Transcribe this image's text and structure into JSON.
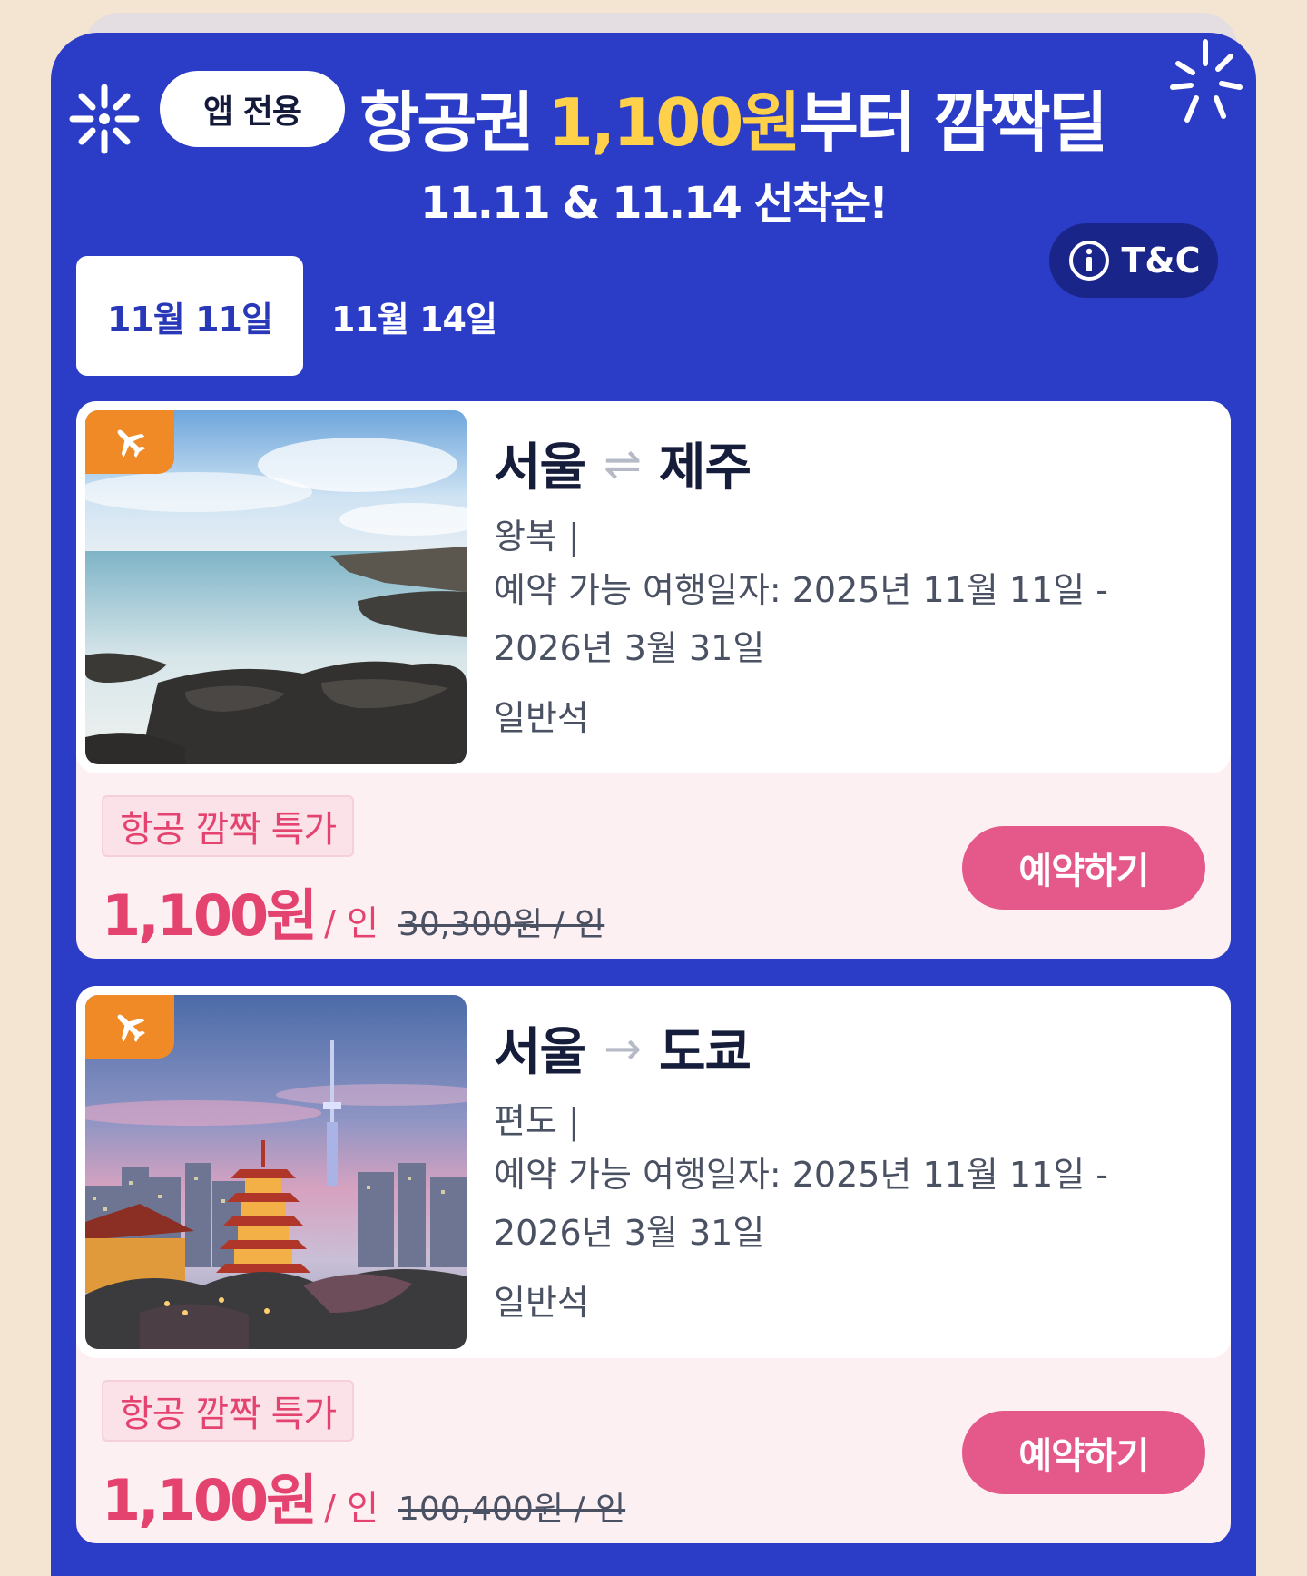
{
  "header": {
    "badge_label": "앱 전용",
    "headline_prefix": "항공권",
    "headline_price": "1,100원",
    "headline_suffix": "부터 깜짝딜",
    "subline": "11.11 & 11.14 선착순!",
    "tc_label": "T&C"
  },
  "tabs": [
    {
      "label": "11월 11일",
      "active": true
    },
    {
      "label": "11월 14일",
      "active": false
    }
  ],
  "deals": [
    {
      "origin": "서울",
      "route_arrow": "⇌",
      "destination": "제주",
      "trip_type": "왕복 |",
      "dates_line1": "예약 가능 여행일자:  2025년 11월 11일  -",
      "dates_line2": "2026년 3월 31일",
      "seat_class": "일반석",
      "promo_tag": "항공 깜짝 특가",
      "price": "1,100원",
      "per_person": "/ 인",
      "original_price": "30,300원 / 인",
      "book_label": "예약하기",
      "image": "jeju-coast-photo"
    },
    {
      "origin": "서울",
      "route_arrow": "→",
      "destination": "도쿄",
      "trip_type": "편도 |",
      "dates_line1": "예약 가능 여행일자:  2025년 11월 11일  -",
      "dates_line2": "2026년 3월 31일",
      "seat_class": "일반석",
      "promo_tag": "항공 깜짝 특가",
      "price": "1,100원",
      "per_person": "/ 인",
      "original_price": "100,400원 / 인",
      "book_label": "예약하기",
      "image": "tokyo-skyline-photo"
    }
  ],
  "colors": {
    "page_bg": "#f3e5d2",
    "panel_blue": "#2b3cc6",
    "accent_yellow": "#ffd04a",
    "price_pink": "#e4436f",
    "button_pink": "#e4588a",
    "tag_orange": "#f08a26"
  },
  "icons": {
    "sparkle": "sparkle-icon",
    "info": "info-icon",
    "plane": "airplane-icon"
  }
}
